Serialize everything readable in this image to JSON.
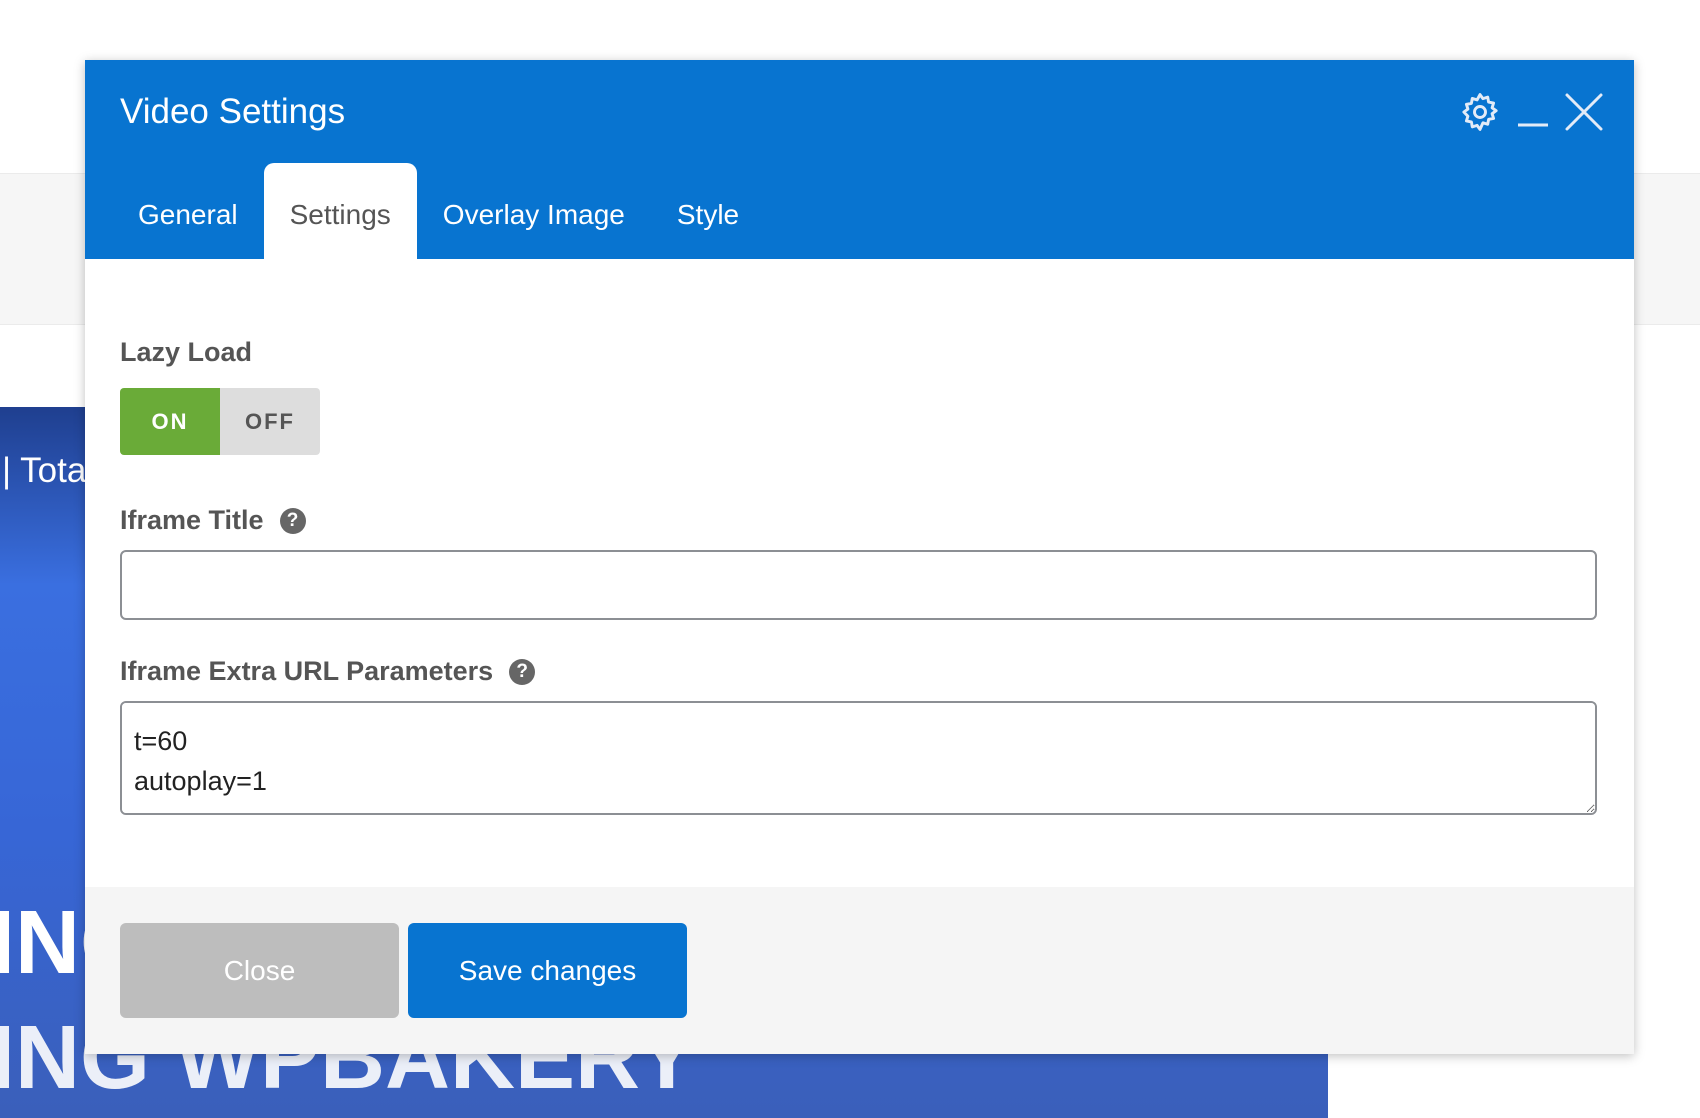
{
  "background": {
    "video_text_1": "| Tota",
    "video_text_2": "INC",
    "video_text_3": "ING WPBAKERY"
  },
  "modal": {
    "title": "Video Settings",
    "header_icons": [
      "gear-icon",
      "minimize-icon",
      "close-icon"
    ],
    "tabs": [
      {
        "label": "General"
      },
      {
        "label": "Settings",
        "active": true
      },
      {
        "label": "Overlay Image"
      },
      {
        "label": "Style"
      }
    ],
    "lazy_load": {
      "label": "Lazy Load",
      "on_label": "ON",
      "off_label": "OFF",
      "value": "ON"
    },
    "iframe_title": {
      "label": "Iframe Title",
      "value": "",
      "placeholder": ""
    },
    "iframe_params": {
      "label": "Iframe Extra URL Parameters",
      "value": "t=60\nautoplay=1"
    },
    "footer": {
      "close_label": "Close",
      "save_label": "Save changes"
    }
  },
  "colors": {
    "accent": "#0874d0",
    "toggle_on": "#6aab38",
    "close_button": "#bdbdbd"
  }
}
